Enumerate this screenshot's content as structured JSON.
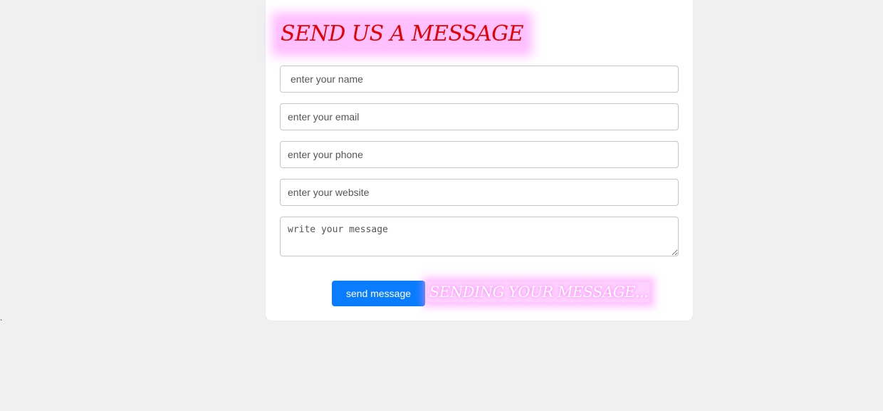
{
  "form": {
    "title": "SEND US A MESSAGE",
    "name_placeholder": "enter your name",
    "email_placeholder": "enter your email",
    "phone_placeholder": "enter your phone",
    "website_placeholder": "enter your website",
    "message_placeholder": "write your message",
    "send_label": "send message",
    "sending_status": "SENDING YOUR MESSAGE..."
  },
  "stray_text": "`",
  "colors": {
    "background": "#f0f0f0",
    "card": "#ffffff",
    "title": "#e60000",
    "glow": "#ff8cff",
    "button": "#0a7cff",
    "button_text": "#ffffff"
  }
}
